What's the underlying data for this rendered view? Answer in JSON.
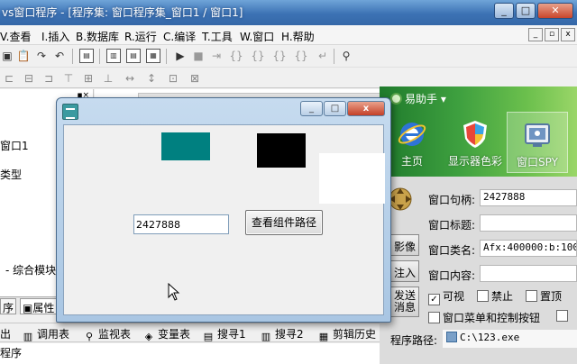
{
  "window": {
    "title": "vs窗口程序 - [程序集: 窗口程序集_窗口1 / 窗口1]",
    "controls": [
      "_",
      "□",
      "✕"
    ]
  },
  "menubar": {
    "items": [
      "V.查看",
      "I.插入",
      "B.数据库",
      "R.运行",
      "C.编译",
      "T.工具",
      "W.窗口",
      "H.帮助"
    ],
    "mdi_controls": [
      "_",
      "▫",
      "x"
    ]
  },
  "left_panel": {
    "lines": [
      "窗口1",
      "类型"
    ],
    "module_label": "- 综合模块",
    "tabs": [
      "序",
      "属性"
    ]
  },
  "bottom_tabs": {
    "items": [
      {
        "label": "出",
        "icon": "output-icon"
      },
      {
        "label": "调用表",
        "icon": "call-table-icon"
      },
      {
        "label": "监视表",
        "icon": "magnifier-icon"
      },
      {
        "label": "变量表",
        "icon": "variable-table-icon"
      },
      {
        "label": "搜寻1",
        "icon": "search-list-icon"
      },
      {
        "label": "搜寻2",
        "icon": "search-list-icon"
      },
      {
        "label": "剪辑历史",
        "icon": "clipboard-history-icon"
      }
    ],
    "bottom_text": "程序"
  },
  "dialog": {
    "controls": [
      "_",
      "□",
      "x"
    ],
    "input_value": "2427888",
    "button_label": "查看组件路径",
    "colors": {
      "teal_block": "#008080",
      "black_block": "#000000",
      "white_block": "#ffffff"
    }
  },
  "helper": {
    "menu_label": "易助手",
    "tools": [
      {
        "label": "主页",
        "icon": "ie-browser-icon"
      },
      {
        "label": "显示器色彩",
        "icon": "color-shield-icon"
      },
      {
        "label": "窗口SPY",
        "icon": "window-spy-icon"
      }
    ],
    "fields": [
      {
        "label": "窗口句柄:",
        "value": "2427888"
      },
      {
        "label": "窗口标题:",
        "value": ""
      },
      {
        "label": "窗口类名:",
        "value": "Afx:400000:b:10003:"
      },
      {
        "label": "窗口内容:",
        "value": ""
      }
    ],
    "side_buttons": [
      "影像",
      "注入",
      "发送\n消息"
    ],
    "checkboxes": [
      {
        "label": "可视",
        "checked": true
      },
      {
        "label": "禁止",
        "checked": false
      },
      {
        "label": "置顶",
        "checked": false
      },
      {
        "label": "窗口菜单和控制按钮",
        "checked": false
      }
    ],
    "path_label": "程序路径:",
    "path_value": "C:\\123.exe"
  }
}
